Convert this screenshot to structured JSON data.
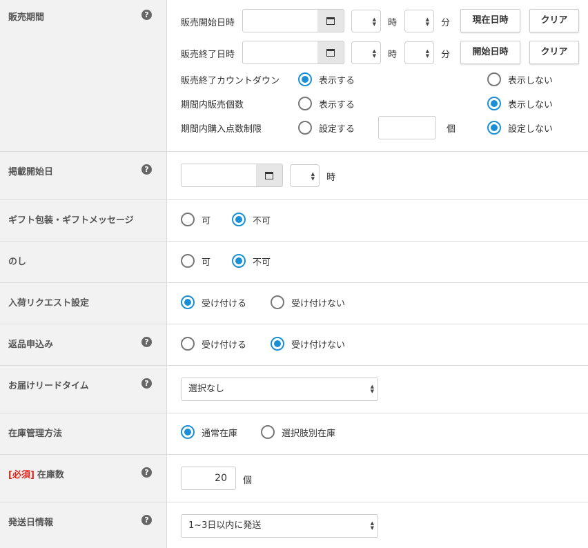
{
  "sales_period": {
    "label": "販売期間",
    "start_label": "販売開始日時",
    "end_label": "販売終了日時",
    "hour_unit": "時",
    "minute_unit": "分",
    "now_button": "現在日時",
    "start_button": "開始日時",
    "clear_button": "クリア",
    "countdown_label": "販売終了カウントダウン",
    "countdown_show": "表示する",
    "countdown_hide": "表示しない",
    "count_label": "期間内販売個数",
    "count_show": "表示する",
    "count_hide": "表示しない",
    "limit_label": "期間内購入点数制限",
    "limit_set": "設定する",
    "limit_unit": "個",
    "limit_unset": "設定しない"
  },
  "publish_start": {
    "label": "掲載開始日",
    "hour_unit": "時"
  },
  "gift": {
    "label": "ギフト包装・ギフトメッセージ",
    "yes": "可",
    "no": "不可"
  },
  "noshi": {
    "label": "のし",
    "yes": "可",
    "no": "不可"
  },
  "restock_request": {
    "label": "入荷リクエスト設定",
    "accept": "受け付ける",
    "reject": "受け付けない"
  },
  "returns": {
    "label": "返品申込み",
    "accept": "受け付ける",
    "reject": "受け付けない"
  },
  "lead_time": {
    "label": "お届けリードタイム",
    "selected": "選択なし"
  },
  "stock_method": {
    "label": "在庫管理方法",
    "normal": "通常在庫",
    "by_option": "選択肢別在庫"
  },
  "stock_count": {
    "required": "[必須]",
    "label": "在庫数",
    "value": "20",
    "unit": "個"
  },
  "shipping_info": {
    "label": "発送日情報",
    "selected": "1~3日以内に発送"
  },
  "help_glyph": "?",
  "icons": {
    "calendar": "calendar-icon",
    "help": "help-icon"
  },
  "colors": {
    "accent": "#1a8fd6",
    "required": "#e0261b",
    "label_bg": "#f2f2f2"
  }
}
